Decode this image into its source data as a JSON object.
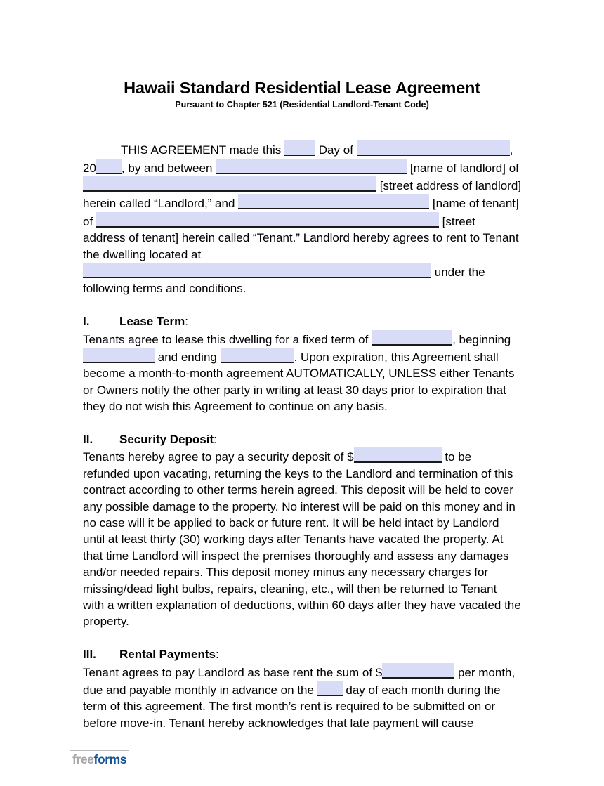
{
  "document": {
    "title": "Hawaii Standard Residential Lease Agreement",
    "subtitle": "Pursuant to Chapter 521 (Residential Landlord-Tenant Code)"
  },
  "intro": {
    "t1": "THIS AGREEMENT made this",
    "t2": "Day of",
    "t3": ",",
    "t4": "20",
    "t5": ", by and between",
    "t6": "[name of landlord]",
    "t7": "of",
    "t8": "[street address of landlord] herein called “Landlord,” and",
    "t9": "[name of tenant] of",
    "t10": "[street address of tenant] herein called “Tenant.”  Landlord hereby agrees to rent to Tenant the dwelling located at",
    "t11": "under the following terms and conditions."
  },
  "sections": [
    {
      "number": "I.",
      "heading": "Lease Term",
      "colon": ":",
      "body": {
        "t1": "Tenants agree to lease this dwelling for a fixed term of",
        "t2": ", beginning",
        "t3": "and ending",
        "t4": ".  Upon expiration, this Agreement shall become a month-to-month agreement AUTOMATICALLY, UNLESS either Tenants or Owners notify the other party in writing at least 30 days prior to expiration that they do not wish this Agreement to continue on any basis."
      }
    },
    {
      "number": "II.",
      "heading": "Security Deposit",
      "colon": ":",
      "body": {
        "t1": "Tenants hereby agree to pay a security deposit of $",
        "t2": "to be refunded upon vacating, returning the keys to the Landlord and termination of this contract according to other terms herein agreed. This deposit will be held to cover any possible damage to the property. No interest will be paid on this money and in no case will it be applied to back or future rent. It will be held intact by Landlord until at least thirty (30) working days after Tenants have vacated the property. At that time Landlord will inspect the premises thoroughly and assess any damages and/or needed repairs. This deposit money minus any necessary charges for missing/dead light bulbs, repairs, cleaning, etc., will then be returned to Tenant with a written explanation of deductions, within 60 days after they have vacated the property."
      }
    },
    {
      "number": "III.",
      "heading": "Rental Payments",
      "colon": ":",
      "body": {
        "t1": "Tenant agrees to pay Landlord as base rent the sum of $",
        "t2": "per month, due and payable monthly in advance on the",
        "t3": "day of each month during the term of this agreement.  The first month’s rent is required to be submitted on or before move-in. Tenant hereby acknowledges that late payment will cause"
      }
    }
  ],
  "fields": {
    "day": "",
    "month": "",
    "year": "",
    "landlord_name": "",
    "landlord_address": "",
    "tenant_name": "",
    "tenant_address": "",
    "dwelling_address": "",
    "lease_term": "",
    "lease_begin": "",
    "lease_end": "",
    "security_deposit": "",
    "base_rent": "",
    "due_day": ""
  },
  "footer": {
    "logo_part1": "free",
    "logo_part2": "forms"
  },
  "colors": {
    "field_fill": "#d8dcf7",
    "field_underline": "#1a1a1a",
    "logo_gray": "#a8a8a8",
    "logo_blue": "#13539c",
    "text": "#000000",
    "page_background": "#ffffff"
  }
}
